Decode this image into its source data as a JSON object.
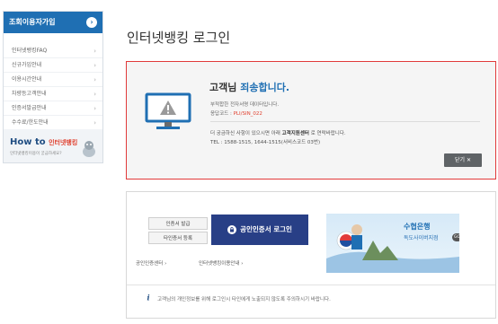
{
  "sidebar": {
    "header": "조회이용자가입",
    "items": [
      {
        "label": "인터넷뱅킹FAQ"
      },
      {
        "label": "신규가입안내"
      },
      {
        "label": "이용시간안내"
      },
      {
        "label": "차량등고객안내"
      },
      {
        "label": "인증서발급안내"
      },
      {
        "label": "수수료/한도안내"
      }
    ],
    "howto": {
      "title_main": "How to",
      "title_sub": "인터넷뱅킹",
      "desc": "인터넷뱅킹이용이 궁금하세요?"
    }
  },
  "page": {
    "title": "인터넷뱅킹 로그인"
  },
  "error": {
    "title_prefix": "고객님",
    "title_emph": "죄송합니다.",
    "message": "부적합한 전자서명 데이터입니다.",
    "code_label": "응답코드 :",
    "code_value": "PLI/SIN_022",
    "contact_prefix": "더 궁금하신 사항이 있으시면 아래",
    "contact_center": "고객지원센터",
    "contact_suffix": "로 연락바랍니다.",
    "tel": "TEL : 1588-1515, 1644-1515(서비스코드 03번)",
    "close_label": "닫기 ✕"
  },
  "login": {
    "cert_issue_label": "인증서 발급",
    "other_cert_label": "타인증서 등록",
    "cert_login_label": "공인인증서 로그인",
    "link_cert_center": "공인인증센터",
    "link_usage_guide": "인터넷뱅킹이용안내",
    "ad_title": "수협은행",
    "ad_subtitle": "독도사이버지점",
    "ad_go": "GO",
    "notice": "고객님의 개인정보를 위해 로그인시 타인에게 노출되지 않도록 주의하시기 바랍니다."
  },
  "colors": {
    "primary_blue": "#1f6fb3",
    "navy_button": "#283f86",
    "error_border": "#e13a3a",
    "error_text_red": "#e0402f"
  }
}
